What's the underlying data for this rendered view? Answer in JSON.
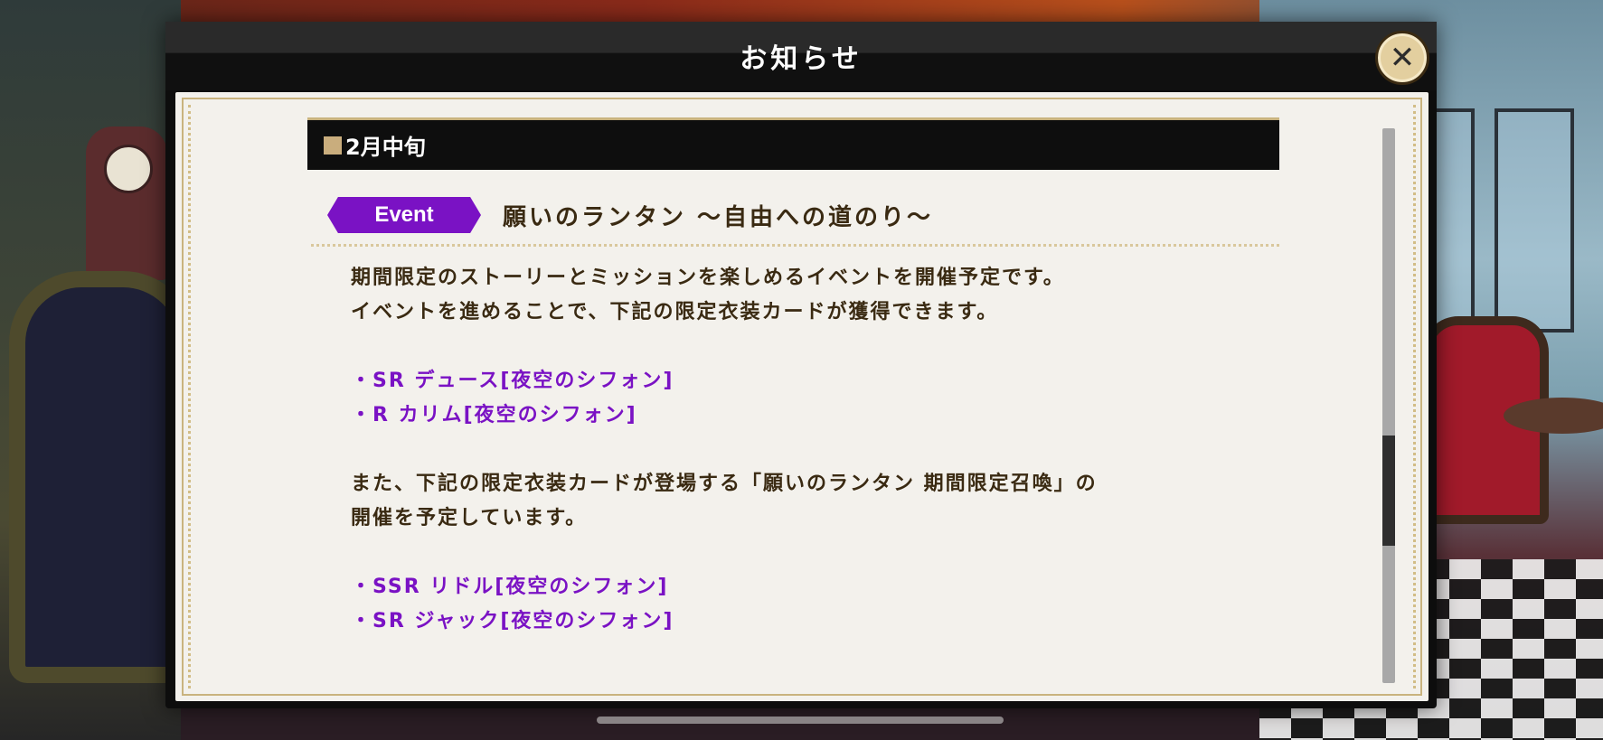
{
  "dialog": {
    "title": "お知らせ",
    "close_icon": "close-icon"
  },
  "section": {
    "title": "2月中旬",
    "marker_color": "#c9ad7d"
  },
  "event": {
    "badge_label": "Event",
    "badge_color": "#7a12c4",
    "title": "願いのランタン ～自由への道のり～"
  },
  "body": {
    "para1_line1": "期間限定のストーリーとミッションを楽しめるイベントを開催予定です。",
    "para1_line2": "イベントを進めることで、下記の限定衣装カードが獲得できます。",
    "cards1": [
      "・SR デュース[夜空のシフォン]",
      "・R カリム[夜空のシフォン]"
    ],
    "para2_line1": "また、下記の限定衣装カードが登場する「願いのランタン 期間限定召喚」の",
    "para2_line2": "開催を予定しています。",
    "cards2": [
      "・SSR リドル[夜空のシフォン]",
      "・SR ジャック[夜空のシフォン]"
    ]
  },
  "scroll": {
    "position_fraction": 0.55
  }
}
